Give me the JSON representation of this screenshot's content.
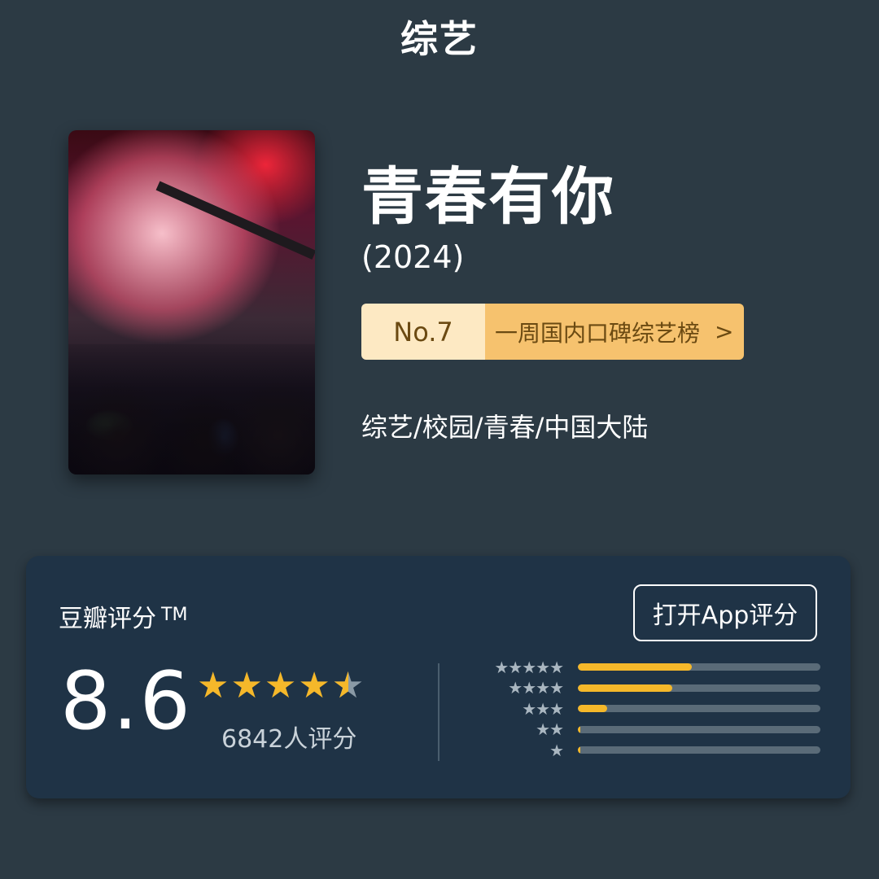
{
  "header": {
    "category": "综艺"
  },
  "poster": {
    "alt": "青春有你"
  },
  "show": {
    "title": "青春有你",
    "year": "(2024)",
    "rank_no": "No.7",
    "rank_list": "一周国内口碑综艺榜",
    "rank_arrow": ">",
    "genres": "综艺/校园/青春/中国大陆"
  },
  "rating": {
    "source": "豆瓣评分",
    "tm": "TM",
    "open_app": "打开App评分",
    "score": "8.6",
    "stars": 4.5,
    "votes": "6842人评分",
    "distribution": [
      {
        "stars": 5,
        "label": "★★★★★",
        "fraction": 0.47
      },
      {
        "stars": 4,
        "label": "★★★★",
        "fraction": 0.39
      },
      {
        "stars": 3,
        "label": "★★★",
        "fraction": 0.12
      },
      {
        "stars": 2,
        "label": "★★",
        "fraction": 0.01
      },
      {
        "stars": 1,
        "label": "★",
        "fraction": 0.01
      }
    ]
  },
  "colors": {
    "background": "#2c3a44",
    "card": "#1f3346",
    "accent": "#f5b82a",
    "badge_light": "#fde9c3",
    "badge_dark": "#f6c26e"
  }
}
